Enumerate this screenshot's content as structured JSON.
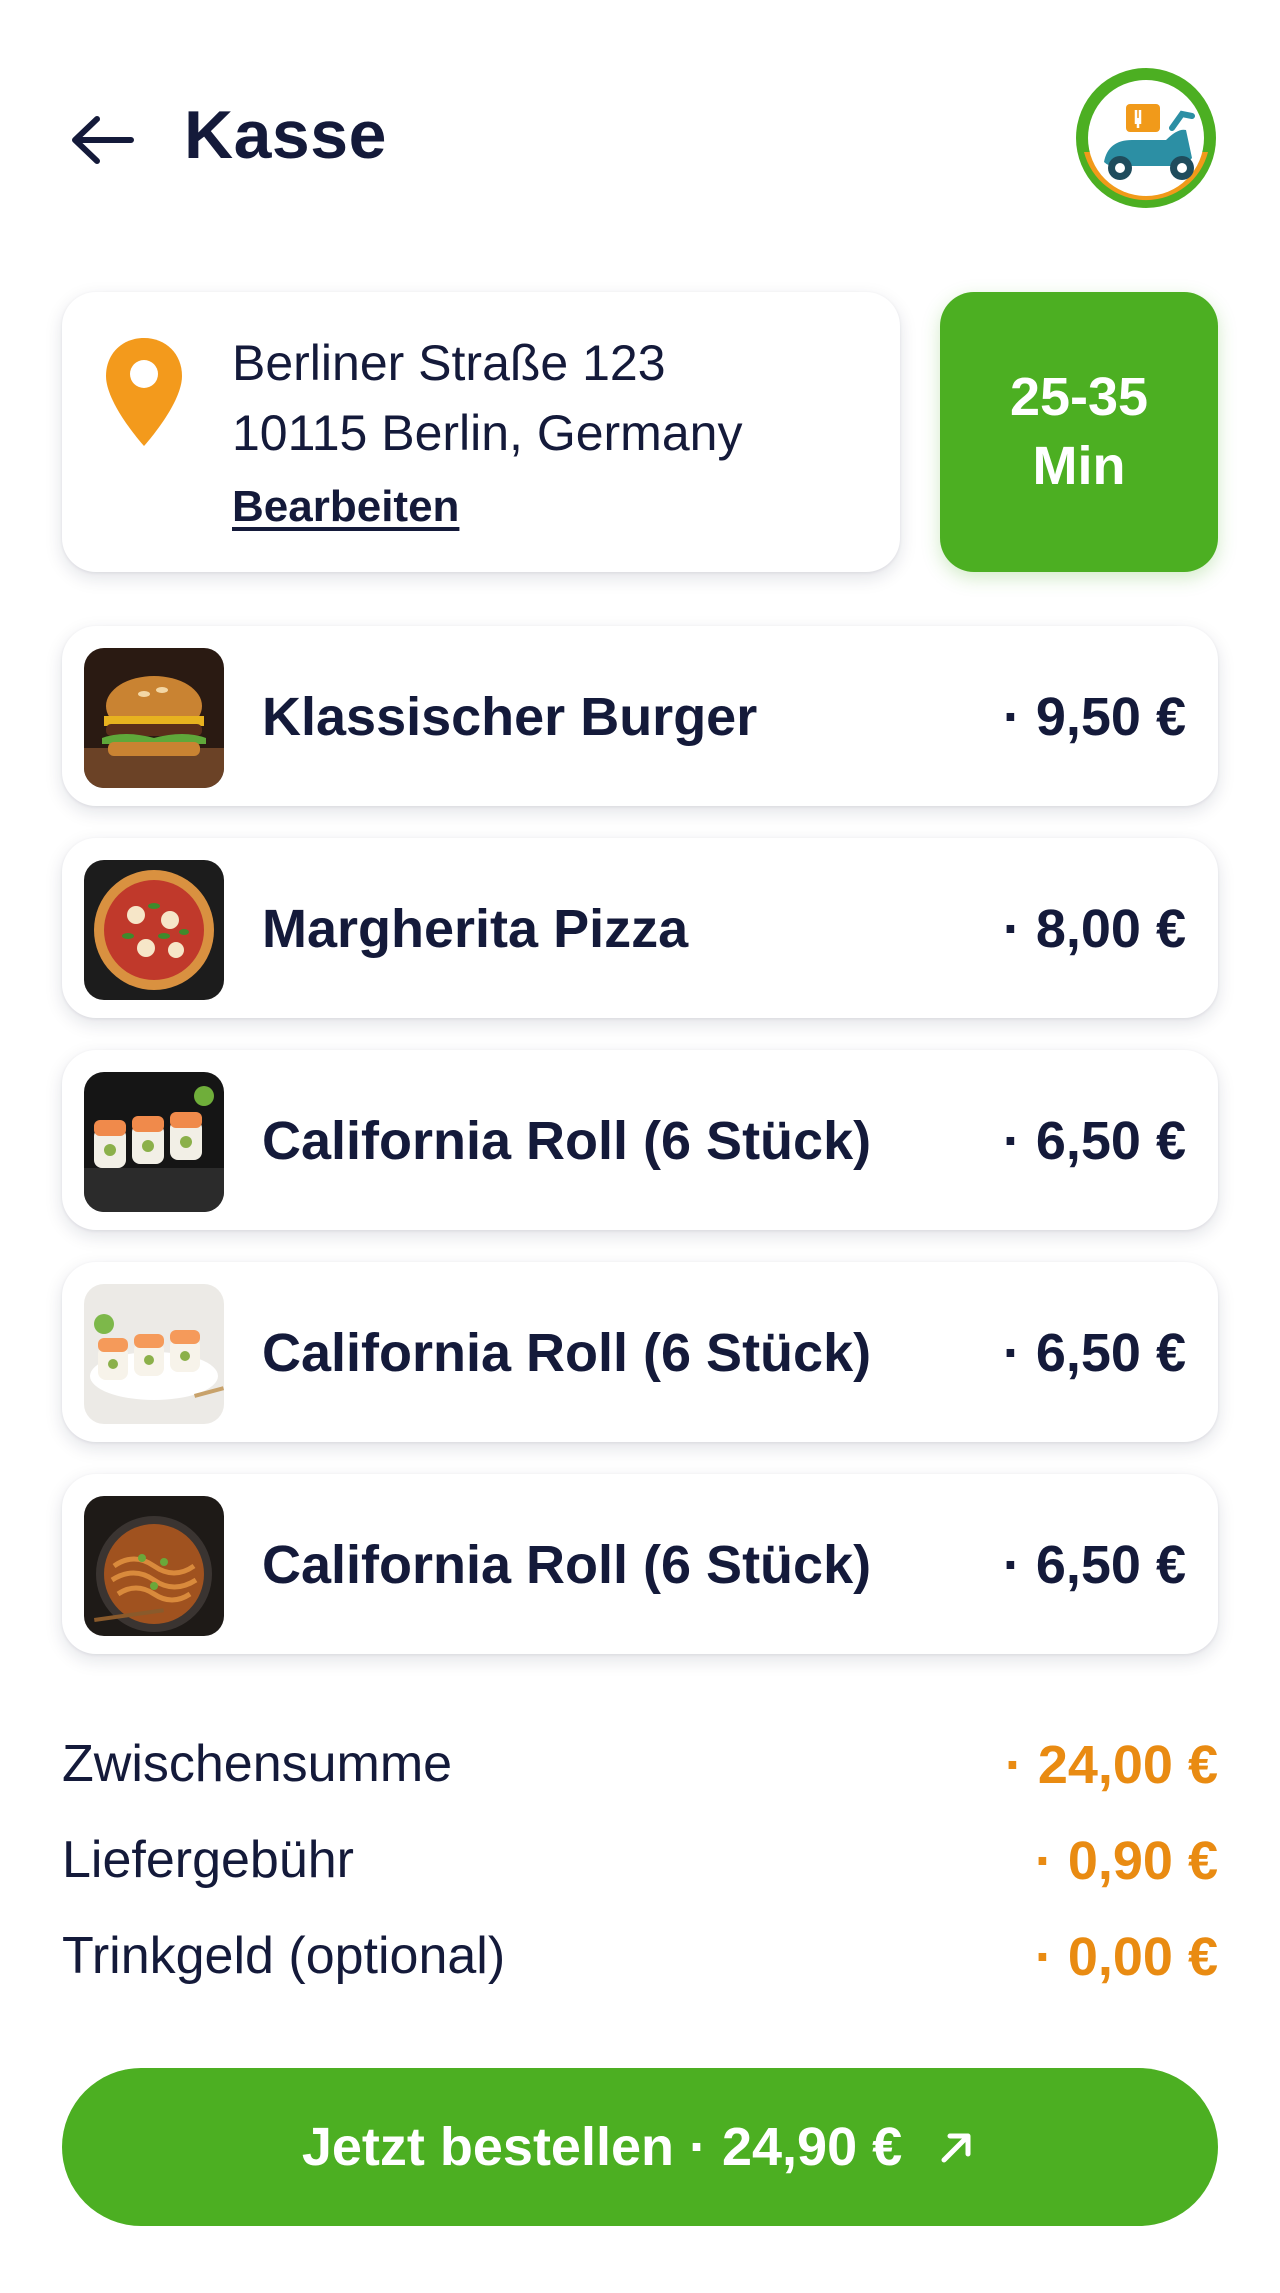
{
  "header": {
    "title": "Kasse",
    "back_icon": "arrow-left-icon",
    "logo_icon": "delivery-scooter-logo"
  },
  "address": {
    "icon": "location-pin-icon",
    "line1": "Berliner Straße 123",
    "line2": "10115 Berlin, Germany",
    "edit_label": "Bearbeiten"
  },
  "eta": {
    "line1": "25-35",
    "line2": "Min"
  },
  "items": [
    {
      "name": "Klassischer Burger",
      "price": "· 9,50 €",
      "image": "burger"
    },
    {
      "name": "Margherita Pizza",
      "price": "· 8,00 €",
      "image": "pizza"
    },
    {
      "name": "California Roll (6 Stück)",
      "price": "· 6,50 €",
      "image": "sushi-dark"
    },
    {
      "name": "California Roll (6 Stück)",
      "price": "· 6,50 €",
      "image": "sushi-light"
    },
    {
      "name": "California Roll (6 Stück)",
      "price": "· 6,50 €",
      "image": "noodles"
    }
  ],
  "summary": {
    "subtotal_label": "Zwischensumme",
    "subtotal_value": "· 24,00 €",
    "delivery_label": "Liefergebühr",
    "delivery_value": "· 0,90 €",
    "tip_label": "Trinkgeld (optional)",
    "tip_value": "· 0,00 €"
  },
  "order_button": {
    "label": "Jetzt bestellen · 24,90 €",
    "icon": "arrow-up-right-icon"
  },
  "colors": {
    "primary_green": "#4caf22",
    "accent_orange": "#e98b12",
    "text_dark": "#141a3a"
  }
}
